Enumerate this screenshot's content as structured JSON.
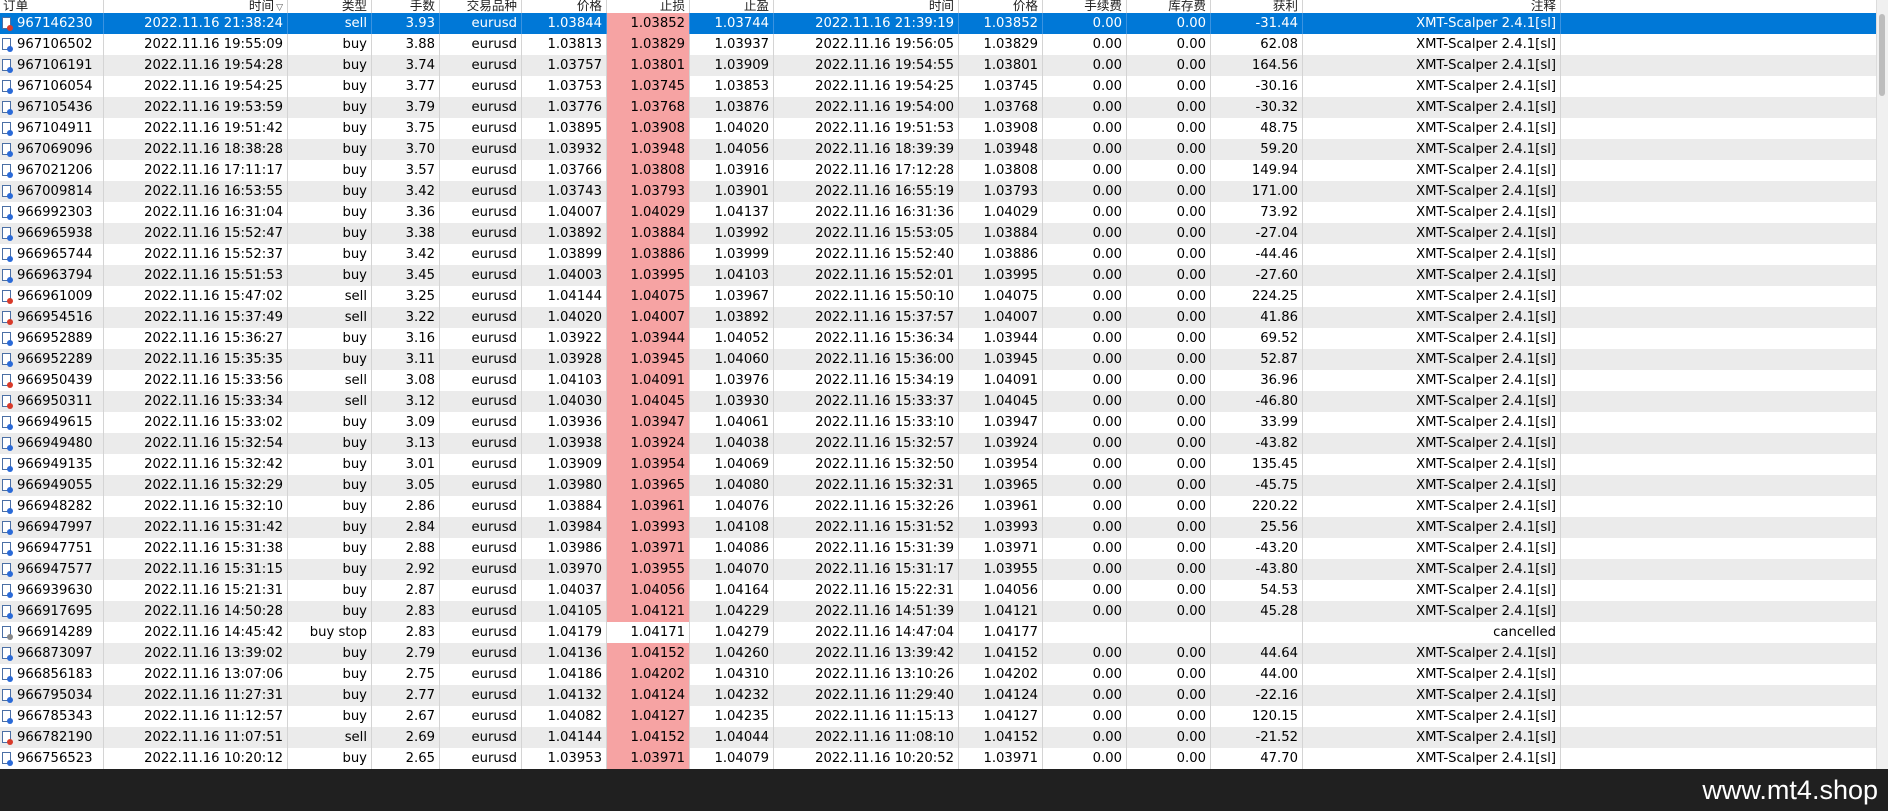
{
  "table": {
    "columns": [
      "订单",
      "时间",
      "类型",
      "手数",
      "交易品种",
      "价格",
      "止损",
      "止盈",
      "时间",
      "价格",
      "手续费",
      "库存费",
      "获利",
      "注释"
    ],
    "sort_indicator": "▽",
    "rows": [
      [
        "967146230",
        "2022.11.16 21:38:24",
        "sell",
        "3.93",
        "eurusd",
        "1.03844",
        "1.03852",
        "1.03744",
        "2022.11.16 21:39:19",
        "1.03852",
        "0.00",
        "0.00",
        "-31.44",
        "XMT-Scalper 2.4.1[sl]"
      ],
      [
        "967106502",
        "2022.11.16 19:55:09",
        "buy",
        "3.88",
        "eurusd",
        "1.03813",
        "1.03829",
        "1.03937",
        "2022.11.16 19:56:05",
        "1.03829",
        "0.00",
        "0.00",
        "62.08",
        "XMT-Scalper 2.4.1[sl]"
      ],
      [
        "967106191",
        "2022.11.16 19:54:28",
        "buy",
        "3.74",
        "eurusd",
        "1.03757",
        "1.03801",
        "1.03909",
        "2022.11.16 19:54:55",
        "1.03801",
        "0.00",
        "0.00",
        "164.56",
        "XMT-Scalper 2.4.1[sl]"
      ],
      [
        "967106054",
        "2022.11.16 19:54:25",
        "buy",
        "3.77",
        "eurusd",
        "1.03753",
        "1.03745",
        "1.03853",
        "2022.11.16 19:54:25",
        "1.03745",
        "0.00",
        "0.00",
        "-30.16",
        "XMT-Scalper 2.4.1[sl]"
      ],
      [
        "967105436",
        "2022.11.16 19:53:59",
        "buy",
        "3.79",
        "eurusd",
        "1.03776",
        "1.03768",
        "1.03876",
        "2022.11.16 19:54:00",
        "1.03768",
        "0.00",
        "0.00",
        "-30.32",
        "XMT-Scalper 2.4.1[sl]"
      ],
      [
        "967104911",
        "2022.11.16 19:51:42",
        "buy",
        "3.75",
        "eurusd",
        "1.03895",
        "1.03908",
        "1.04020",
        "2022.11.16 19:51:53",
        "1.03908",
        "0.00",
        "0.00",
        "48.75",
        "XMT-Scalper 2.4.1[sl]"
      ],
      [
        "967069096",
        "2022.11.16 18:38:28",
        "buy",
        "3.70",
        "eurusd",
        "1.03932",
        "1.03948",
        "1.04056",
        "2022.11.16 18:39:39",
        "1.03948",
        "0.00",
        "0.00",
        "59.20",
        "XMT-Scalper 2.4.1[sl]"
      ],
      [
        "967021206",
        "2022.11.16 17:11:17",
        "buy",
        "3.57",
        "eurusd",
        "1.03766",
        "1.03808",
        "1.03916",
        "2022.11.16 17:12:28",
        "1.03808",
        "0.00",
        "0.00",
        "149.94",
        "XMT-Scalper 2.4.1[sl]"
      ],
      [
        "967009814",
        "2022.11.16 16:53:55",
        "buy",
        "3.42",
        "eurusd",
        "1.03743",
        "1.03793",
        "1.03901",
        "2022.11.16 16:55:19",
        "1.03793",
        "0.00",
        "0.00",
        "171.00",
        "XMT-Scalper 2.4.1[sl]"
      ],
      [
        "966992303",
        "2022.11.16 16:31:04",
        "buy",
        "3.36",
        "eurusd",
        "1.04007",
        "1.04029",
        "1.04137",
        "2022.11.16 16:31:36",
        "1.04029",
        "0.00",
        "0.00",
        "73.92",
        "XMT-Scalper 2.4.1[sl]"
      ],
      [
        "966965938",
        "2022.11.16 15:52:47",
        "buy",
        "3.38",
        "eurusd",
        "1.03892",
        "1.03884",
        "1.03992",
        "2022.11.16 15:53:05",
        "1.03884",
        "0.00",
        "0.00",
        "-27.04",
        "XMT-Scalper 2.4.1[sl]"
      ],
      [
        "966965744",
        "2022.11.16 15:52:37",
        "buy",
        "3.42",
        "eurusd",
        "1.03899",
        "1.03886",
        "1.03999",
        "2022.11.16 15:52:40",
        "1.03886",
        "0.00",
        "0.00",
        "-44.46",
        "XMT-Scalper 2.4.1[sl]"
      ],
      [
        "966963794",
        "2022.11.16 15:51:53",
        "buy",
        "3.45",
        "eurusd",
        "1.04003",
        "1.03995",
        "1.04103",
        "2022.11.16 15:52:01",
        "1.03995",
        "0.00",
        "0.00",
        "-27.60",
        "XMT-Scalper 2.4.1[sl]"
      ],
      [
        "966961009",
        "2022.11.16 15:47:02",
        "sell",
        "3.25",
        "eurusd",
        "1.04144",
        "1.04075",
        "1.03967",
        "2022.11.16 15:50:10",
        "1.04075",
        "0.00",
        "0.00",
        "224.25",
        "XMT-Scalper 2.4.1[sl]"
      ],
      [
        "966954516",
        "2022.11.16 15:37:49",
        "sell",
        "3.22",
        "eurusd",
        "1.04020",
        "1.04007",
        "1.03892",
        "2022.11.16 15:37:57",
        "1.04007",
        "0.00",
        "0.00",
        "41.86",
        "XMT-Scalper 2.4.1[sl]"
      ],
      [
        "966952889",
        "2022.11.16 15:36:27",
        "buy",
        "3.16",
        "eurusd",
        "1.03922",
        "1.03944",
        "1.04052",
        "2022.11.16 15:36:34",
        "1.03944",
        "0.00",
        "0.00",
        "69.52",
        "XMT-Scalper 2.4.1[sl]"
      ],
      [
        "966952289",
        "2022.11.16 15:35:35",
        "buy",
        "3.11",
        "eurusd",
        "1.03928",
        "1.03945",
        "1.04060",
        "2022.11.16 15:36:00",
        "1.03945",
        "0.00",
        "0.00",
        "52.87",
        "XMT-Scalper 2.4.1[sl]"
      ],
      [
        "966950439",
        "2022.11.16 15:33:56",
        "sell",
        "3.08",
        "eurusd",
        "1.04103",
        "1.04091",
        "1.03976",
        "2022.11.16 15:34:19",
        "1.04091",
        "0.00",
        "0.00",
        "36.96",
        "XMT-Scalper 2.4.1[sl]"
      ],
      [
        "966950311",
        "2022.11.16 15:33:34",
        "sell",
        "3.12",
        "eurusd",
        "1.04030",
        "1.04045",
        "1.03930",
        "2022.11.16 15:33:37",
        "1.04045",
        "0.00",
        "0.00",
        "-46.80",
        "XMT-Scalper 2.4.1[sl]"
      ],
      [
        "966949615",
        "2022.11.16 15:33:02",
        "buy",
        "3.09",
        "eurusd",
        "1.03936",
        "1.03947",
        "1.04061",
        "2022.11.16 15:33:10",
        "1.03947",
        "0.00",
        "0.00",
        "33.99",
        "XMT-Scalper 2.4.1[sl]"
      ],
      [
        "966949480",
        "2022.11.16 15:32:54",
        "buy",
        "3.13",
        "eurusd",
        "1.03938",
        "1.03924",
        "1.04038",
        "2022.11.16 15:32:57",
        "1.03924",
        "0.00",
        "0.00",
        "-43.82",
        "XMT-Scalper 2.4.1[sl]"
      ],
      [
        "966949135",
        "2022.11.16 15:32:42",
        "buy",
        "3.01",
        "eurusd",
        "1.03909",
        "1.03954",
        "1.04069",
        "2022.11.16 15:32:50",
        "1.03954",
        "0.00",
        "0.00",
        "135.45",
        "XMT-Scalper 2.4.1[sl]"
      ],
      [
        "966949055",
        "2022.11.16 15:32:29",
        "buy",
        "3.05",
        "eurusd",
        "1.03980",
        "1.03965",
        "1.04080",
        "2022.11.16 15:32:31",
        "1.03965",
        "0.00",
        "0.00",
        "-45.75",
        "XMT-Scalper 2.4.1[sl]"
      ],
      [
        "966948282",
        "2022.11.16 15:32:10",
        "buy",
        "2.86",
        "eurusd",
        "1.03884",
        "1.03961",
        "1.04076",
        "2022.11.16 15:32:26",
        "1.03961",
        "0.00",
        "0.00",
        "220.22",
        "XMT-Scalper 2.4.1[sl]"
      ],
      [
        "966947997",
        "2022.11.16 15:31:42",
        "buy",
        "2.84",
        "eurusd",
        "1.03984",
        "1.03993",
        "1.04108",
        "2022.11.16 15:31:52",
        "1.03993",
        "0.00",
        "0.00",
        "25.56",
        "XMT-Scalper 2.4.1[sl]"
      ],
      [
        "966947751",
        "2022.11.16 15:31:38",
        "buy",
        "2.88",
        "eurusd",
        "1.03986",
        "1.03971",
        "1.04086",
        "2022.11.16 15:31:39",
        "1.03971",
        "0.00",
        "0.00",
        "-43.20",
        "XMT-Scalper 2.4.1[sl]"
      ],
      [
        "966947577",
        "2022.11.16 15:31:15",
        "buy",
        "2.92",
        "eurusd",
        "1.03970",
        "1.03955",
        "1.04070",
        "2022.11.16 15:31:17",
        "1.03955",
        "0.00",
        "0.00",
        "-43.80",
        "XMT-Scalper 2.4.1[sl]"
      ],
      [
        "966939630",
        "2022.11.16 15:21:31",
        "buy",
        "2.87",
        "eurusd",
        "1.04037",
        "1.04056",
        "1.04164",
        "2022.11.16 15:22:31",
        "1.04056",
        "0.00",
        "0.00",
        "54.53",
        "XMT-Scalper 2.4.1[sl]"
      ],
      [
        "966917695",
        "2022.11.16 14:50:28",
        "buy",
        "2.83",
        "eurusd",
        "1.04105",
        "1.04121",
        "1.04229",
        "2022.11.16 14:51:39",
        "1.04121",
        "0.00",
        "0.00",
        "45.28",
        "XMT-Scalper 2.4.1[sl]"
      ],
      [
        "966914289",
        "2022.11.16 14:45:42",
        "buy stop",
        "2.83",
        "eurusd",
        "1.04179",
        "1.04171",
        "1.04279",
        "2022.11.16 14:47:04",
        "1.04177",
        "",
        "",
        "",
        "cancelled"
      ],
      [
        "966873097",
        "2022.11.16 13:39:02",
        "buy",
        "2.79",
        "eurusd",
        "1.04136",
        "1.04152",
        "1.04260",
        "2022.11.16 13:39:42",
        "1.04152",
        "0.00",
        "0.00",
        "44.64",
        "XMT-Scalper 2.4.1[sl]"
      ],
      [
        "966856183",
        "2022.11.16 13:07:06",
        "buy",
        "2.75",
        "eurusd",
        "1.04186",
        "1.04202",
        "1.04310",
        "2022.11.16 13:10:26",
        "1.04202",
        "0.00",
        "0.00",
        "44.00",
        "XMT-Scalper 2.4.1[sl]"
      ],
      [
        "966795034",
        "2022.11.16 11:27:31",
        "buy",
        "2.77",
        "eurusd",
        "1.04132",
        "1.04124",
        "1.04232",
        "2022.11.16 11:29:40",
        "1.04124",
        "0.00",
        "0.00",
        "-22.16",
        "XMT-Scalper 2.4.1[sl]"
      ],
      [
        "966785343",
        "2022.11.16 11:12:57",
        "buy",
        "2.67",
        "eurusd",
        "1.04082",
        "1.04127",
        "1.04235",
        "2022.11.16 11:15:13",
        "1.04127",
        "0.00",
        "0.00",
        "120.15",
        "XMT-Scalper 2.4.1[sl]"
      ],
      [
        "966782190",
        "2022.11.16 11:07:51",
        "sell",
        "2.69",
        "eurusd",
        "1.04144",
        "1.04152",
        "1.04044",
        "2022.11.16 11:08:10",
        "1.04152",
        "0.00",
        "0.00",
        "-21.52",
        "XMT-Scalper 2.4.1[sl]"
      ],
      [
        "966756523",
        "2022.11.16 10:20:12",
        "buy",
        "2.65",
        "eurusd",
        "1.03953",
        "1.03971",
        "1.04079",
        "2022.11.16 10:20:52",
        "1.03971",
        "0.00",
        "0.00",
        "47.70",
        "XMT-Scalper 2.4.1[sl]"
      ]
    ]
  },
  "colors": {
    "selection": "#0078d7",
    "stop_loss_fill": "#f6a3a3",
    "row_alt": "#ebebeb"
  },
  "icons": {
    "order_row": "order-document-icon"
  },
  "watermark": "www.mt4.shop"
}
